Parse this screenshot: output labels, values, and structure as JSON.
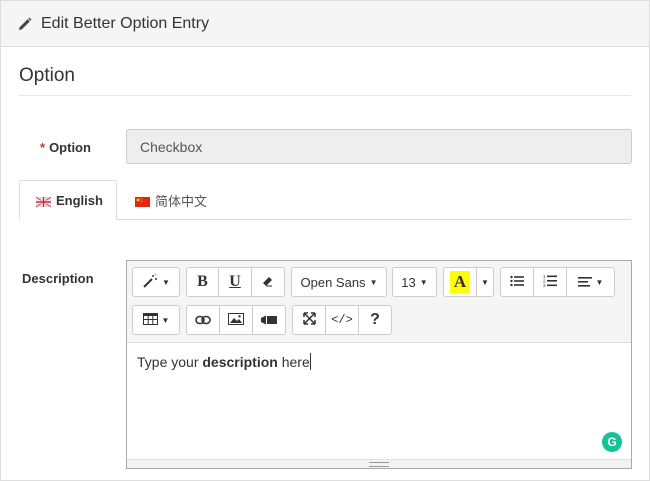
{
  "panel": {
    "title": "Edit Better Option Entry",
    "icon": "pencil-icon"
  },
  "section": {
    "title": "Option"
  },
  "option_field": {
    "required_mark": "*",
    "label": "Option",
    "value": "Checkbox"
  },
  "tabs": [
    {
      "label": "English",
      "flag": "uk-flag-icon",
      "active": true
    },
    {
      "label": "简体中文",
      "flag": "china-flag-icon",
      "active": false
    }
  ],
  "description": {
    "label": "Description",
    "toolbar": {
      "style_icon": "magic-wand-icon",
      "bold": "B",
      "underline": "U",
      "eraser_icon": "eraser-icon",
      "font_name": "Open Sans",
      "font_size": "13",
      "color_letter": "A",
      "highlight_color": "#ffff00",
      "unordered_list_icon": "unordered-list-icon",
      "ordered_list_icon": "ordered-list-icon",
      "align_icon": "align-left-icon",
      "table_icon": "table-icon",
      "link_icon": "link-icon",
      "picture_icon": "picture-icon",
      "video_icon": "video-icon",
      "fullscreen_icon": "fullscreen-icon",
      "code_label": "</>",
      "help_label": "?"
    },
    "content": {
      "before": "Type your ",
      "bold": "description",
      "after": " here"
    },
    "grammarly_letter": "G"
  }
}
